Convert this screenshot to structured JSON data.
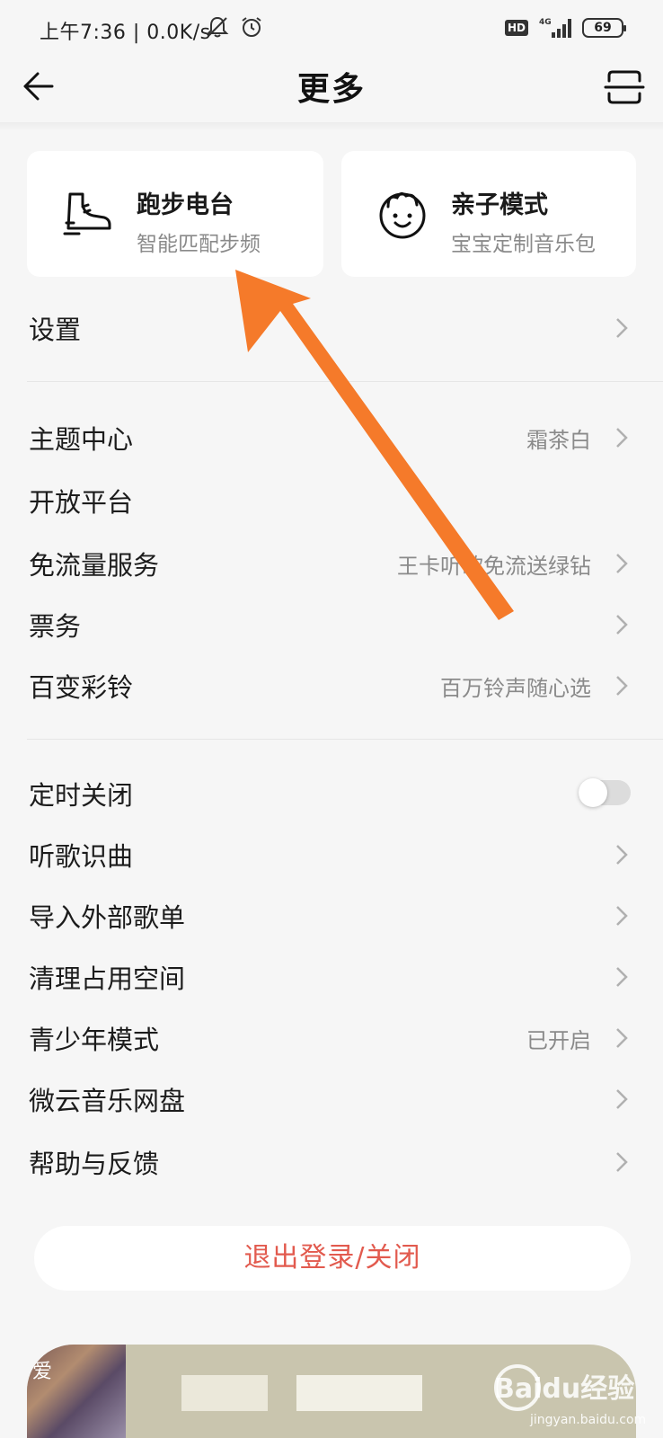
{
  "status_bar": {
    "time": "上午7:36 | 0.0K/s",
    "network": "4G",
    "hd": "HD",
    "battery": "69"
  },
  "header": {
    "title": "更多"
  },
  "cards": [
    {
      "title": "跑步电台",
      "subtitle": "智能匹配步频",
      "icon": "running-shoe-icon"
    },
    {
      "title": "亲子模式",
      "subtitle": "宝宝定制音乐包",
      "icon": "baby-face-icon"
    }
  ],
  "settings": {
    "label": "设置"
  },
  "group1": [
    {
      "label": "主题中心",
      "value": "霜茶白",
      "chevron": true
    },
    {
      "label": "开放平台",
      "value": "",
      "chevron": false
    },
    {
      "label": "免流量服务",
      "value": "王卡听歌免流送绿钻",
      "chevron": true
    },
    {
      "label": "票务",
      "value": "",
      "chevron": true
    },
    {
      "label": "百变彩铃",
      "value": "百万铃声随心选",
      "chevron": true
    }
  ],
  "group2": [
    {
      "label": "定时关闭",
      "toggle": false
    },
    {
      "label": "听歌识曲",
      "value": ""
    },
    {
      "label": "导入外部歌单",
      "value": ""
    },
    {
      "label": "清理占用空间",
      "value": ""
    },
    {
      "label": "青少年模式",
      "value": "已开启"
    },
    {
      "label": "微云音乐网盘",
      "value": ""
    },
    {
      "label": "帮助与反馈",
      "value": ""
    }
  ],
  "logout": {
    "label": "退出登录/关闭"
  },
  "player": {
    "cover_text": "爱"
  },
  "watermark": {
    "text": "Baidu经验",
    "sub": "jingyan.baidu.com"
  },
  "colors": {
    "background": "#f6f6f6",
    "card": "#ffffff",
    "logout_text": "#e25a4e",
    "annotation_arrow": "#f57a2a"
  }
}
